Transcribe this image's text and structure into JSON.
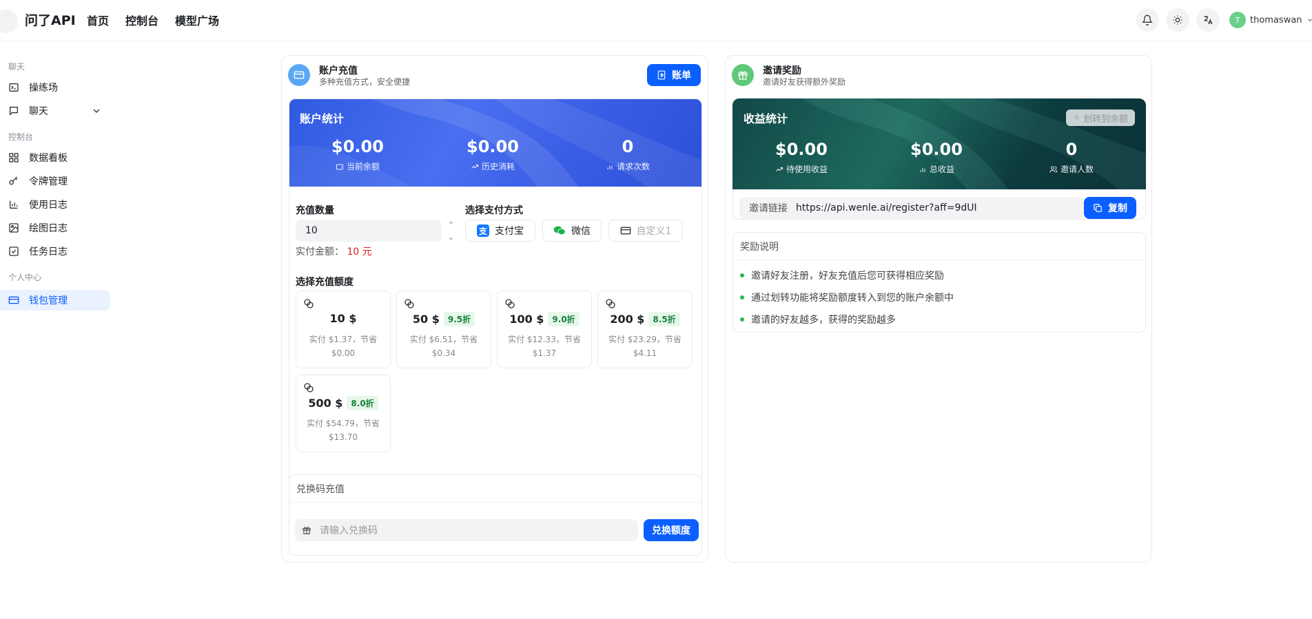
{
  "header": {
    "brand": "问了API",
    "nav": [
      "首页",
      "控制台",
      "模型广场"
    ],
    "username": "thomaswan",
    "avatar_letter": "T"
  },
  "sidebar": {
    "sections": {
      "chat": "聊天",
      "console": "控制台",
      "personal": "个人中心"
    },
    "items": {
      "playground": "操练场",
      "chat": "聊天",
      "dashboard": "数据看板",
      "tokens": "令牌管理",
      "usage_log": "使用日志",
      "draw_log": "绘图日志",
      "task_log": "任务日志",
      "wallet": "钱包管理"
    }
  },
  "recharge": {
    "title": "账户充值",
    "subtitle": "多种充值方式，安全便捷",
    "bill_button": "账单",
    "stats": {
      "title": "账户统计",
      "balance": "$0.00",
      "balance_label": "当前余额",
      "history": "$0.00",
      "history_label": "历史消耗",
      "requests": "0",
      "requests_label": "请求次数"
    },
    "amount_label": "充值数量",
    "amount_value": "10",
    "pay_label": "实付金额：",
    "pay_value": "10 元",
    "method_label": "选择支付方式",
    "methods": {
      "alipay": "支付宝",
      "wechat": "微信",
      "custom": "自定义1"
    },
    "preset_label": "选择充值额度",
    "presets": [
      {
        "amount": "10 $",
        "discount": "",
        "line1": "实付 $1.37，节省",
        "line2": "$0.00"
      },
      {
        "amount": "50 $",
        "discount": "9.5折",
        "line1": "实付 $6.51，节省",
        "line2": "$0.34"
      },
      {
        "amount": "100 $",
        "discount": "9.0折",
        "line1": "实付 $12.33，节省",
        "line2": "$1.37"
      },
      {
        "amount": "200 $",
        "discount": "8.5折",
        "line1": "实付 $23.29，节省",
        "line2": "$4.11"
      },
      {
        "amount": "500 $",
        "discount": "8.0折",
        "line1": "实付 $54.79，节省",
        "line2": "$13.70"
      }
    ],
    "redeem": {
      "title": "兑换码充值",
      "placeholder": "请输入兑换码",
      "button": "兑换额度"
    }
  },
  "invite": {
    "title": "邀请奖励",
    "subtitle": "邀请好友获得额外奖励",
    "stats": {
      "title": "收益统计",
      "transfer_button": "划转到余额",
      "pending": "$0.00",
      "pending_label": "待使用收益",
      "total": "$0.00",
      "total_label": "总收益",
      "invites": "0",
      "invites_label": "邀请人数"
    },
    "link_label": "邀请链接",
    "link_value": "https://api.wenle.ai/register?aff=9dUI",
    "copy_button": "复制",
    "rules_title": "奖励说明",
    "rules": [
      "邀请好友注册，好友充值后您可获得相应奖励",
      "通过划转功能将奖励额度转入到您的账户余额中",
      "邀请的好友越多，获得的奖励越多"
    ]
  },
  "colors": {
    "accent": "#0b5fff",
    "recharge_panel": "#3a5fe0",
    "invite_panel": "#0f4a4a",
    "discount": "#17803d",
    "pay_amount": "#e02020"
  }
}
